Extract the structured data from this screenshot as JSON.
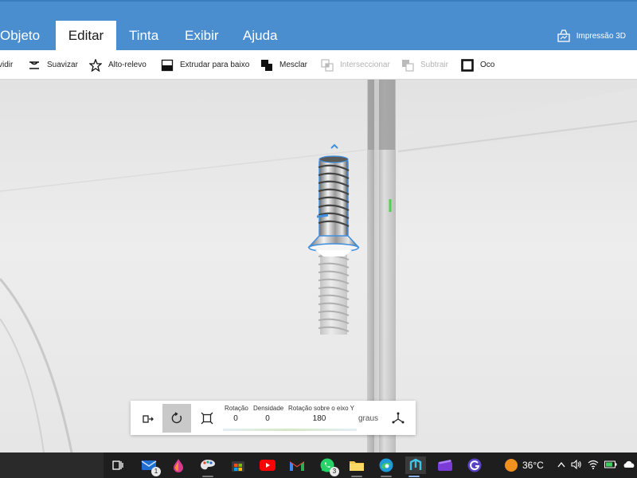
{
  "menu": {
    "tabs": [
      {
        "label": "Objeto"
      },
      {
        "label": "Editar"
      },
      {
        "label": "Tinta"
      },
      {
        "label": "Exibir"
      },
      {
        "label": "Ajuda"
      }
    ],
    "active_tab": "Editar",
    "app_button": "Impressão 3D"
  },
  "ribbon": {
    "items": [
      {
        "label": "vidir",
        "icon": "divide-icon",
        "enabled": true
      },
      {
        "label": "Suavizar",
        "icon": "smooth-icon",
        "enabled": true
      },
      {
        "label": "Alto-relevo",
        "icon": "star-icon",
        "enabled": true
      },
      {
        "label": "Extrudar para baixo",
        "icon": "extrude-down-icon",
        "enabled": true
      },
      {
        "label": "Mesclar",
        "icon": "merge-icon",
        "enabled": true
      },
      {
        "label": "Interseccionar",
        "icon": "intersect-icon",
        "enabled": false
      },
      {
        "label": "Subtrair",
        "icon": "subtract-icon",
        "enabled": false
      },
      {
        "label": "Oco",
        "icon": "hollow-icon",
        "enabled": true
      }
    ]
  },
  "panel": {
    "rotation_label": "Rotação",
    "rotation_value": "0",
    "density_label": "Densidade",
    "density_value": "0",
    "axis_label": "Rotação sobre o eixo Y",
    "axis_value": "180",
    "unit": "graus"
  },
  "taskbar": {
    "mail_badge": "1",
    "whatsapp_badge": "3",
    "temperature": "36°C"
  },
  "colors": {
    "menubar": "#4a8ed0",
    "selection": "#3f8fe0",
    "taskbar": "#1e1e1e"
  }
}
